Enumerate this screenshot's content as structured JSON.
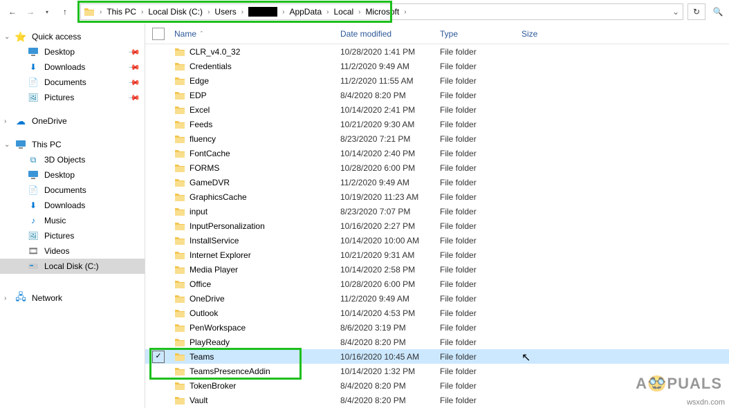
{
  "breadcrumb": [
    "This PC",
    "Local Disk (C:)",
    "Users",
    "",
    "AppData",
    "Local",
    "Microsoft"
  ],
  "columns": {
    "name": "Name",
    "date": "Date modified",
    "type": "Type",
    "size": "Size"
  },
  "sidebar": {
    "quick": {
      "label": "Quick access",
      "items": [
        {
          "label": "Desktop",
          "icon": "desktop",
          "pin": true
        },
        {
          "label": "Downloads",
          "icon": "download",
          "pin": true
        },
        {
          "label": "Documents",
          "icon": "doc",
          "pin": true
        },
        {
          "label": "Pictures",
          "icon": "pic",
          "pin": true
        }
      ]
    },
    "onedrive": {
      "label": "OneDrive"
    },
    "thispc": {
      "label": "This PC",
      "items": [
        {
          "label": "3D Objects",
          "icon": "3d"
        },
        {
          "label": "Desktop",
          "icon": "desktop"
        },
        {
          "label": "Documents",
          "icon": "doc"
        },
        {
          "label": "Downloads",
          "icon": "download"
        },
        {
          "label": "Music",
          "icon": "music"
        },
        {
          "label": "Pictures",
          "icon": "pic"
        },
        {
          "label": "Videos",
          "icon": "video"
        },
        {
          "label": "Local Disk (C:)",
          "icon": "disk",
          "selected": true
        }
      ]
    },
    "network": {
      "label": "Network"
    }
  },
  "files": [
    {
      "name": "CLR_v4.0_32",
      "date": "10/28/2020 1:41 PM",
      "type": "File folder"
    },
    {
      "name": "Credentials",
      "date": "11/2/2020 9:49 AM",
      "type": "File folder"
    },
    {
      "name": "Edge",
      "date": "11/2/2020 11:55 AM",
      "type": "File folder"
    },
    {
      "name": "EDP",
      "date": "8/4/2020 8:20 PM",
      "type": "File folder"
    },
    {
      "name": "Excel",
      "date": "10/14/2020 2:41 PM",
      "type": "File folder"
    },
    {
      "name": "Feeds",
      "date": "10/21/2020 9:30 AM",
      "type": "File folder"
    },
    {
      "name": "fluency",
      "date": "8/23/2020 7:21 PM",
      "type": "File folder"
    },
    {
      "name": "FontCache",
      "date": "10/14/2020 2:40 PM",
      "type": "File folder"
    },
    {
      "name": "FORMS",
      "date": "10/28/2020 6:00 PM",
      "type": "File folder"
    },
    {
      "name": "GameDVR",
      "date": "11/2/2020 9:49 AM",
      "type": "File folder"
    },
    {
      "name": "GraphicsCache",
      "date": "10/19/2020 11:23 AM",
      "type": "File folder"
    },
    {
      "name": "input",
      "date": "8/23/2020 7:07 PM",
      "type": "File folder"
    },
    {
      "name": "InputPersonalization",
      "date": "10/16/2020 2:27 PM",
      "type": "File folder"
    },
    {
      "name": "InstallService",
      "date": "10/14/2020 10:00 AM",
      "type": "File folder"
    },
    {
      "name": "Internet Explorer",
      "date": "10/21/2020 9:31 AM",
      "type": "File folder"
    },
    {
      "name": "Media Player",
      "date": "10/14/2020 2:58 PM",
      "type": "File folder"
    },
    {
      "name": "Office",
      "date": "10/28/2020 6:00 PM",
      "type": "File folder"
    },
    {
      "name": "OneDrive",
      "date": "11/2/2020 9:49 AM",
      "type": "File folder"
    },
    {
      "name": "Outlook",
      "date": "10/14/2020 4:53 PM",
      "type": "File folder"
    },
    {
      "name": "PenWorkspace",
      "date": "8/6/2020 3:19 PM",
      "type": "File folder"
    },
    {
      "name": "PlayReady",
      "date": "8/4/2020 8:20 PM",
      "type": "File folder"
    },
    {
      "name": "Teams",
      "date": "10/16/2020 10:45 AM",
      "type": "File folder",
      "selected": true,
      "checked": true
    },
    {
      "name": "TeamsPresenceAddin",
      "date": "10/14/2020 1:32 PM",
      "type": "File folder"
    },
    {
      "name": "TokenBroker",
      "date": "8/4/2020 8:20 PM",
      "type": "File folder"
    },
    {
      "name": "Vault",
      "date": "8/4/2020 8:20 PM",
      "type": "File folder"
    }
  ],
  "watermark": "A🥸PUALS",
  "wm_url": "wsxdn.com"
}
